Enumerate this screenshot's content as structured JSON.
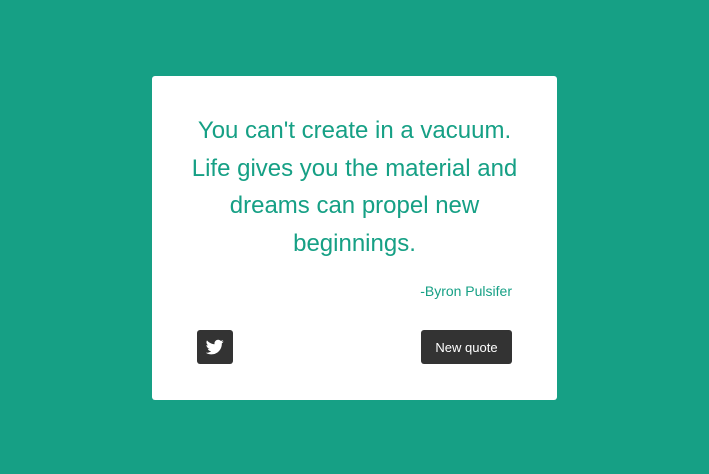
{
  "quote": {
    "text": "You can't create in a vacuum. Life gives you the material and dreams can propel new beginnings.",
    "author": "-Byron Pulsifer"
  },
  "actions": {
    "tweet_icon": "twitter-icon",
    "new_quote_label": "New quote"
  },
  "colors": {
    "background": "#16a085",
    "card": "#ffffff",
    "accent_text": "#16a085",
    "button": "#333333",
    "button_text": "#ffffff"
  }
}
